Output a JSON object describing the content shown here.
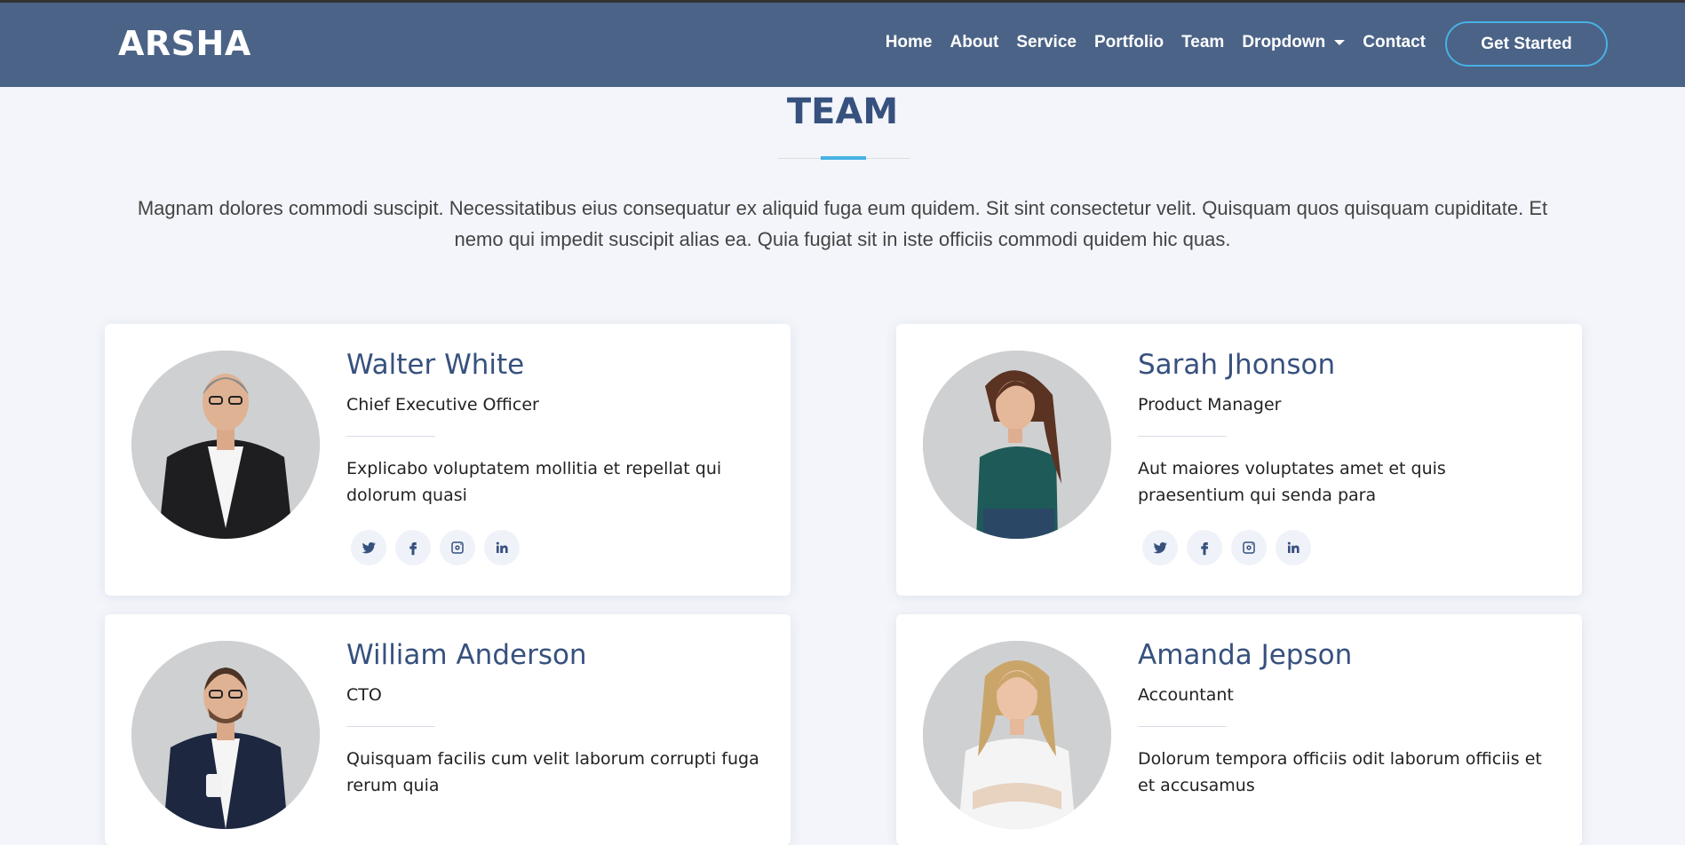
{
  "brand": {
    "logo": "ARSHA"
  },
  "nav": {
    "items": [
      "Home",
      "About",
      "Service",
      "Portfolio",
      "Team",
      "Dropdown",
      "Contact"
    ],
    "cta": "Get Started"
  },
  "section": {
    "title": "TEAM",
    "description": "Magnam dolores commodi suscipit. Necessitatibus eius consequatur ex aliquid fuga eum quidem. Sit sint consectetur velit. Quisquam quos quisquam cupiditate. Et nemo qui impedit suscipit alias ea. Quia fugiat sit in iste officiis commodi quidem hic quas."
  },
  "colors": {
    "header": "#4b6387",
    "title": "#37517e",
    "accent": "#47b2e4",
    "background": "#f3f5fa"
  },
  "team": [
    {
      "name": "Walter White",
      "role": "Chief Executive Officer",
      "bio": "Explicabo voluptatem mollitia et repellat qui dolorum quasi"
    },
    {
      "name": "Sarah Jhonson",
      "role": "Product Manager",
      "bio": "Aut maiores voluptates amet et quis praesentium qui senda para"
    },
    {
      "name": "William Anderson",
      "role": "CTO",
      "bio": "Quisquam facilis cum velit laborum corrupti fuga rerum quia"
    },
    {
      "name": "Amanda Jepson",
      "role": "Accountant",
      "bio": "Dolorum tempora officiis odit laborum officiis et et accusamus"
    }
  ],
  "social_icons": [
    "twitter-icon",
    "facebook-icon",
    "instagram-icon",
    "linkedin-icon"
  ]
}
